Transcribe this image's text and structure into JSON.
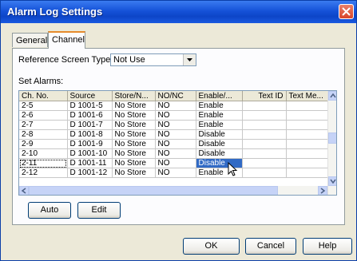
{
  "window": {
    "title": "Alarm Log Settings"
  },
  "tabs": [
    {
      "label": "General"
    },
    {
      "label": "Channel"
    }
  ],
  "reference_screen": {
    "label": "Reference Screen Type:",
    "value": "Not Use"
  },
  "set_alarms": {
    "label": "Set Alarms:"
  },
  "table": {
    "columns": [
      "Ch. No.",
      "Source",
      "Store/N...",
      "NO/NC",
      "Enable/...",
      "Text ID",
      "Text Me..."
    ],
    "rows": [
      [
        "2-5",
        "D 1001-5",
        "No Store",
        "NO",
        "Enable",
        "",
        ""
      ],
      [
        "2-6",
        "D 1001-6",
        "No Store",
        "NO",
        "Enable",
        "",
        ""
      ],
      [
        "2-7",
        "D 1001-7",
        "No Store",
        "NO",
        "Enable",
        "",
        ""
      ],
      [
        "2-8",
        "D 1001-8",
        "No Store",
        "NO",
        "Disable",
        "",
        ""
      ],
      [
        "2-9",
        "D 1001-9",
        "No Store",
        "NO",
        "Disable",
        "",
        ""
      ],
      [
        "2-10",
        "D 1001-10",
        "No Store",
        "NO",
        "Disable",
        "",
        ""
      ],
      [
        "2-11",
        "D 1001-11",
        "No Store",
        "NO",
        "Disable",
        "",
        ""
      ],
      [
        "2-12",
        "D 1001-12",
        "No Store",
        "NO",
        "Enable",
        "",
        ""
      ]
    ]
  },
  "buttons": {
    "auto": "Auto",
    "edit": "Edit",
    "ok": "OK",
    "cancel": "Cancel",
    "help": "Help"
  },
  "colors": {
    "titlebar": "#0d45c8",
    "selection": "#316ac5",
    "close": "#d9452a"
  }
}
